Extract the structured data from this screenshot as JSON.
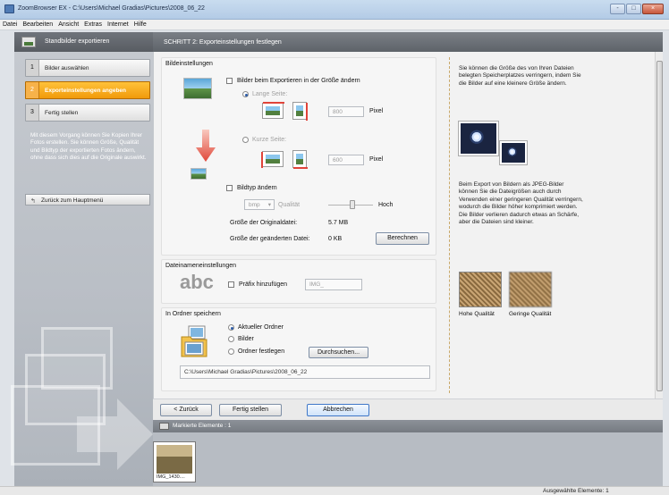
{
  "window": {
    "title": "ZoomBrowser EX - C:\\Users\\Michael Gradias\\Pictures\\2008_06_22",
    "controls": [
      "-",
      "□",
      "×"
    ]
  },
  "menu": [
    "Datei",
    "Bearbeiten",
    "Ansicht",
    "Extras",
    "Internet",
    "Hilfe"
  ],
  "left_panel": {
    "title": "Standbilder exportieren",
    "steps": [
      {
        "num": "1",
        "label": "Bilder auswählen"
      },
      {
        "num": "2",
        "label": "Exporteinstellungen angeben"
      },
      {
        "num": "3",
        "label": "Fertig stellen"
      }
    ],
    "description": "Mit diesem Vorgang können Sie Kopien Ihrer Fotos erstellen. Sie können Größe, Qualität und Bildtyp der exportierten Fotos ändern, ohne dass sich dies auf die Originale auswirkt.",
    "back_button": "Zurück zum Hauptmenü"
  },
  "header": {
    "title": "SCHRITT 2: Exporteinstellungen festlegen"
  },
  "image_settings": {
    "title": "Bildeinstellungen",
    "resize_checkbox": "Bilder beim Exportieren in der Größe ändern",
    "long_side_label": "Lange Seite:",
    "long_side_value": "800",
    "short_side_label": "Kurze Seite:",
    "short_side_value": "600",
    "unit": "Pixel",
    "change_type_checkbox": "Bildtyp ändern",
    "type_value": "bmp",
    "quality_label": "Qualität",
    "quality_level": "Hoch",
    "original_size_label": "Größe der Originaldatei:",
    "original_size_value": "5.7 MB",
    "changed_size_label": "Größe der geänderten Datei:",
    "changed_size_value": "0 KB",
    "calculate_button": "Berechnen"
  },
  "filename_settings": {
    "title": "Dateinameneinstellungen",
    "abc": "abc",
    "prefix_checkbox": "Präfix hinzufügen",
    "prefix_value": "IMG_"
  },
  "folder_settings": {
    "title": "In Ordner speichern",
    "options": [
      "Aktueller Ordner",
      "Bilder",
      "Ordner festlegen"
    ],
    "browse_button": "Durchsuchen...",
    "path": "C:\\Users\\Michael Gradias\\Pictures\\2008_06_22"
  },
  "info": {
    "text1": "Sie können die Größe des von Ihren Dateien belegten Speicherplatzes verringern, indem Sie die Bilder auf eine kleinere Größe ändern.",
    "text2": "Beim Export von Bildern als JPEG-Bilder können Sie die Dateigrößen auch durch Verwenden einer geringeren Qualität verringern, wodurch die Bilder höher komprimiert werden. Die Bilder verlieren dadurch etwas an Schärfe, aber die Dateien sind kleiner.",
    "high_quality": "Hohe Qualität",
    "low_quality": "Geringe Qualität"
  },
  "nav": {
    "back": "< Zurück",
    "finish": "Fertig stellen",
    "cancel": "Abbrechen"
  },
  "filmstrip": {
    "header": "Markierte Elemente : 1",
    "thumb_label": "IMG_1430...."
  },
  "status": {
    "selected": "Ausgewählte Elemente: 1"
  }
}
